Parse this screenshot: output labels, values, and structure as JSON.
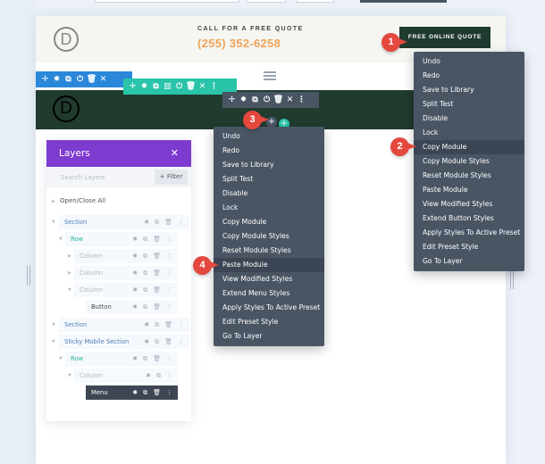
{
  "header": {
    "logo": "D",
    "call_label": "CALL FOR A FREE QUOTE",
    "phone": "(255) 352-6258",
    "quote_button": "FREE ONLINE QUOTE"
  },
  "nav_logo": "D",
  "toolbars": {
    "section": [
      "move-icon",
      "gear-icon",
      "duplicate-icon",
      "power-icon",
      "trash-icon",
      "close-icon"
    ],
    "row": [
      "move-icon",
      "gear-icon",
      "duplicate-icon",
      "columns-icon",
      "power-icon",
      "trash-icon",
      "close-icon",
      "more-icon"
    ],
    "module": [
      "move-icon",
      "gear-icon",
      "duplicate-icon",
      "power-icon",
      "trash-icon",
      "close-icon",
      "more-icon"
    ]
  },
  "badges": [
    "1",
    "2",
    "3",
    "4"
  ],
  "context_menu_button": {
    "items": [
      "Undo",
      "Redo",
      "Save to Library",
      "Split Test",
      "Disable",
      "Lock",
      "Copy Module",
      "Copy Module Styles",
      "Reset Module Styles",
      "Paste Module",
      "View Modified Styles",
      "Extend Button Styles",
      "Apply Styles To Active Preset",
      "Edit Preset Style",
      "Go To Layer"
    ],
    "highlighted": "Copy Module"
  },
  "context_menu_menu": {
    "items": [
      "Undo",
      "Redo",
      "Save to Library",
      "Split Test",
      "Disable",
      "Lock",
      "Copy Module",
      "Copy Module Styles",
      "Reset Module Styles",
      "Paste Module",
      "View Modified Styles",
      "Extend Menu Styles",
      "Apply Styles To Active Preset",
      "Edit Preset Style",
      "Go To Layer"
    ],
    "highlighted": "Paste Module"
  },
  "layers": {
    "title": "Layers",
    "search_placeholder": "Search Layers",
    "filter_label": "+ Filter",
    "open_close_all": "Open/Close All",
    "rows": [
      {
        "label": "Section",
        "type": "section"
      },
      {
        "label": "Row",
        "type": "row"
      },
      {
        "label": "Column",
        "type": "column"
      },
      {
        "label": "Column",
        "type": "column"
      },
      {
        "label": "Column",
        "type": "column"
      },
      {
        "label": "Button",
        "type": "module"
      },
      {
        "label": "Section",
        "type": "section"
      },
      {
        "label": "Sticky Mobile Section",
        "type": "section"
      },
      {
        "label": "Row",
        "type": "row"
      },
      {
        "label": "Column",
        "type": "column"
      },
      {
        "label": "Menu",
        "type": "module-active"
      }
    ]
  },
  "colors": {
    "section": "#2b87da",
    "row": "#29c4a9",
    "module": "#4a5564",
    "layers_header": "#7e3bd0",
    "badge": "#e2483d",
    "phone": "#f0a35a",
    "dark_green": "#213b2f"
  }
}
